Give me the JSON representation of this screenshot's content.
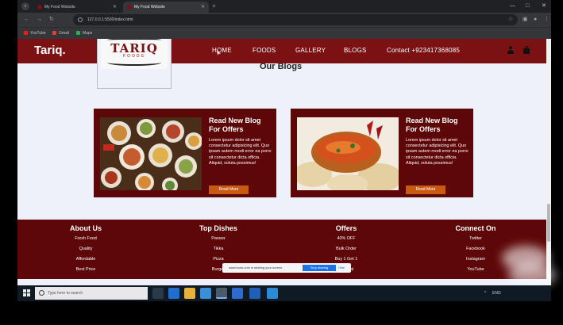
{
  "browser": {
    "tabs": [
      {
        "title": "My Food Website"
      },
      {
        "title": "My Food Website"
      }
    ],
    "new_tab": "+",
    "url": "127.0.0.1:5500/index.html",
    "bookmarks": [
      "YouTube",
      "Gmail",
      "Maps"
    ],
    "window_controls": [
      "—",
      "□",
      "✕"
    ]
  },
  "site": {
    "brand": "Tariq.",
    "logo_text": "TARIQ",
    "logo_sub": "FOODS",
    "nav": [
      "HOME",
      "FOODS",
      "GALLERY",
      "BLOGS",
      "Contact +923417368085"
    ],
    "blogs_heading": "Our Blogs",
    "blogs": [
      {
        "title": "Read New Blog For Offers",
        "body": "Lorem ipsum dolor sit amet consectetur adipisicing elit. Quo ipsam autem modi error ea porro sit consectetur dicta officia. Aliquid, soluta possimus!",
        "button": "Read More"
      },
      {
        "title": "Read New Blog For Offers",
        "body": "Lorem ipsum dolor sit amet consectetur adipisicing elit. Quo ipsam autem modi error ea porro sit consectetur dicta officia. Aliquid, soluta possimus!",
        "button": "Read More"
      }
    ],
    "footer": [
      {
        "title": "About Us",
        "items": [
          "Fresh Food",
          "Quality",
          "Affordable",
          "Best Price"
        ]
      },
      {
        "title": "Top Dishes",
        "items": [
          "Paneer",
          "Tikka",
          "Pizza",
          "Burger"
        ]
      },
      {
        "title": "Offers",
        "items": [
          "40% OFF",
          "Bulk Order",
          "Buy 1 Get 1",
          "Festival"
        ]
      },
      {
        "title": "Connect On",
        "items": [
          "Twitter",
          "Facebook",
          "Instagram",
          "YouTube"
        ]
      }
    ]
  },
  "share_bar": {
    "text": "www.loom.com is sharing your screen.",
    "stop_button": "Stop sharing",
    "hide_button": "Hide"
  },
  "taskbar": {
    "search_placeholder": "Type here to search",
    "tray_text": "ENG"
  },
  "colors": {
    "brand_red": "#7b1113",
    "dark_red": "#5e0708",
    "button_orange": "#c85a12",
    "page_bg": "#eef0fa"
  }
}
